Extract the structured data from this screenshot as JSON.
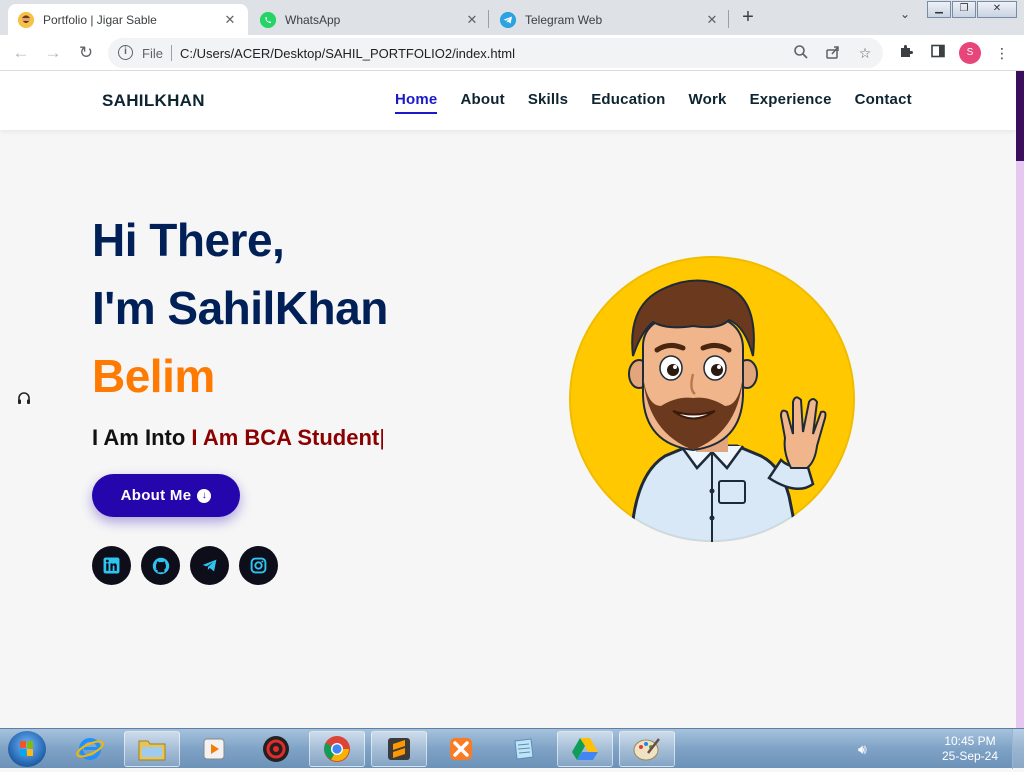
{
  "browser": {
    "tabs": [
      {
        "title": "Portfolio | Jigar Sable",
        "active": true,
        "favicon": "avatar-favicon"
      },
      {
        "title": "WhatsApp",
        "active": false,
        "favicon": "whatsapp-icon"
      },
      {
        "title": "Telegram Web",
        "active": false,
        "favicon": "telegram-icon"
      }
    ],
    "scheme_label": "File",
    "url": "C:/Users/ACER/Desktop/SAHIL_PORTFOLIO2/index.html",
    "profile_initial": "S"
  },
  "site": {
    "brand": "SAHILKHAN",
    "nav": [
      "Home",
      "About",
      "Skills",
      "Education",
      "Work",
      "Experience",
      "Contact"
    ],
    "active_nav": "Home",
    "hero": {
      "line1": "Hi There,",
      "line2": "I'm SahilKhan",
      "line3": "Belim",
      "typing_prefix": "I Am Into",
      "typing_role": "I Am BCA Student",
      "typing_caret": "|",
      "cta_label": "About Me"
    },
    "socials": [
      "linkedin-icon",
      "github-icon",
      "telegram-icon",
      "instagram-icon"
    ]
  },
  "taskbar": {
    "apps": [
      "internet-explorer-icon",
      "file-explorer-icon",
      "media-player-icon",
      "game-app-icon",
      "chrome-icon",
      "sublime-text-icon",
      "xampp-icon",
      "notepad-icon",
      "google-drive-icon",
      "paint-icon"
    ],
    "time": "10:45 PM",
    "date": "25-Sep-24"
  },
  "colors": {
    "navy": "#002057",
    "orange": "#ff7a00",
    "accent": "#2506ad",
    "nav_active": "#1a1ac9",
    "role_red": "#8b0000",
    "avatar_bg": "#ffc800"
  }
}
